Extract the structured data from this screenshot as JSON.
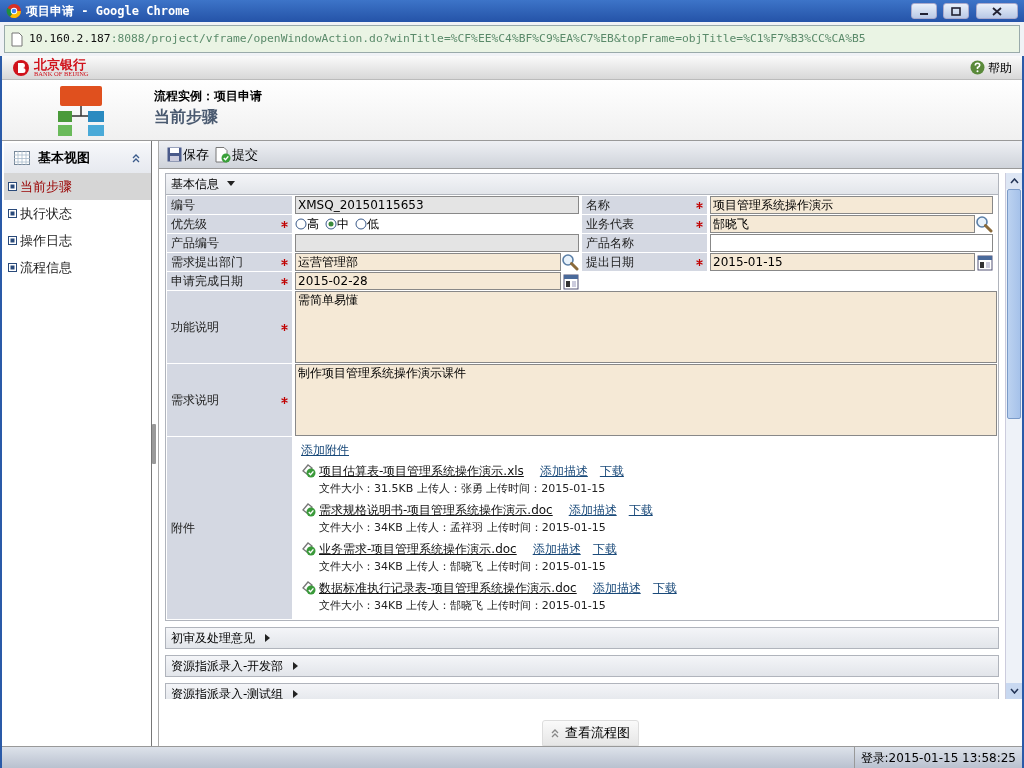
{
  "window": {
    "title": "项目申请 - Google Chrome"
  },
  "address_bar": {
    "host": "10.160.2.187",
    "path": ":8088/project/vframe/openWindowAction.do?winTitle=%CF%EE%C4%BF%C9%EA%C7%EB&topFrame=objTitle=%C1%F7%B3%CC%CA%B5"
  },
  "header": {
    "logo_cn": "北京银行",
    "logo_en": "BANK OF BEIJING",
    "help": "帮助"
  },
  "banner": {
    "caption": "流程实例：项目申请",
    "title": "当前步骤"
  },
  "sidebar": {
    "title": "基本视图",
    "items": [
      {
        "label": "当前步骤",
        "selected": true
      },
      {
        "label": "执行状态",
        "selected": false
      },
      {
        "label": "操作日志",
        "selected": false
      },
      {
        "label": "流程信息",
        "selected": false
      }
    ]
  },
  "toolbar": {
    "buttons": [
      {
        "label": "保存",
        "kind": "save"
      },
      {
        "label": "提交",
        "kind": "submit"
      }
    ]
  },
  "sections": [
    {
      "title": "基本信息",
      "expanded": true,
      "rows": [
        {
          "cells": [
            {
              "label": "编号",
              "required": false,
              "kind": "text",
              "readonly": true,
              "value": "XMSQ_20150115653"
            },
            {
              "label": "名称",
              "required": true,
              "kind": "text",
              "readonly": false,
              "value": "项目管理系统操作演示"
            }
          ]
        },
        {
          "cells": [
            {
              "label": "优先级",
              "required": true,
              "kind": "radio",
              "options": [
                {
                  "label": "高",
                  "selected": false
                },
                {
                  "label": "中",
                  "selected": true
                },
                {
                  "label": "低",
                  "selected": false
                }
              ]
            },
            {
              "label": "业务代表",
              "required": true,
              "kind": "text",
              "readonly": false,
              "value": "郜晓飞",
              "button": {
                "kind": "search"
              }
            }
          ]
        },
        {
          "cells": [
            {
              "label": "产品编号",
              "required": false,
              "kind": "text",
              "readonly": true
            },
            {
              "label": "产品名称",
              "required": false,
              "kind": "text",
              "readonly": false
            }
          ]
        },
        {
          "cells": [
            {
              "label": "需求提出部门",
              "required": true,
              "kind": "text",
              "readonly": false,
              "value": "运营管理部",
              "button": {
                "kind": "search"
              }
            },
            {
              "label": "提出日期",
              "required": true,
              "kind": "text",
              "readonly": false,
              "value": "2015-01-15",
              "button": {
                "kind": "calendar"
              }
            }
          ]
        },
        {
          "cells": [
            {
              "label": "申请完成日期",
              "required": true,
              "kind": "text",
              "readonly": false,
              "value": "2015-02-28",
              "button": {
                "kind": "calendar"
              }
            }
          ]
        },
        {
          "cells": [
            {
              "label": "功能说明",
              "required": true,
              "kind": "textarea",
              "readonly": false,
              "value": "需简单易懂"
            }
          ]
        },
        {
          "cells": [
            {
              "label": "需求说明",
              "required": true,
              "kind": "textarea",
              "readonly": false,
              "value": "制作项目管理系统操作演示课件"
            }
          ]
        },
        {
          "cells": [
            {
              "label": "附件",
              "required": false,
              "kind": "attachments",
              "add_link": "添加附件",
              "files": [
                {
                  "name": "项目估算表-项目管理系统操作演示.xls",
                  "describe": "添加描述",
                  "download": "下载",
                  "info": "文件大小：31.5KB 上传人：张勇 上传时间：2015-01-15"
                },
                {
                  "name": "需求规格说明书-项目管理系统操作演示.doc",
                  "describe": "添加描述",
                  "download": "下载",
                  "info": "文件大小：34KB 上传人：孟祥羽 上传时间：2015-01-15"
                },
                {
                  "name": "业务需求-项目管理系统操作演示.doc",
                  "describe": "添加描述",
                  "download": "下载",
                  "info": "文件大小：34KB 上传人：郜晓飞 上传时间：2015-01-15"
                },
                {
                  "name": "数据标准执行记录表-项目管理系统操作演示.doc",
                  "describe": "添加描述",
                  "download": "下载",
                  "info": "文件大小：34KB 上传人：郜晓飞 上传时间：2015-01-15"
                }
              ]
            }
          ]
        }
      ]
    },
    {
      "title": "初审及处理意见",
      "expanded": false
    },
    {
      "title": "资源指派录入-开发部",
      "expanded": false
    },
    {
      "title": "资源指派录入-测试组",
      "expanded": false
    }
  ],
  "flow_button": "查看流程图",
  "status_bar": "登录:2015-01-15 13:58:25"
}
